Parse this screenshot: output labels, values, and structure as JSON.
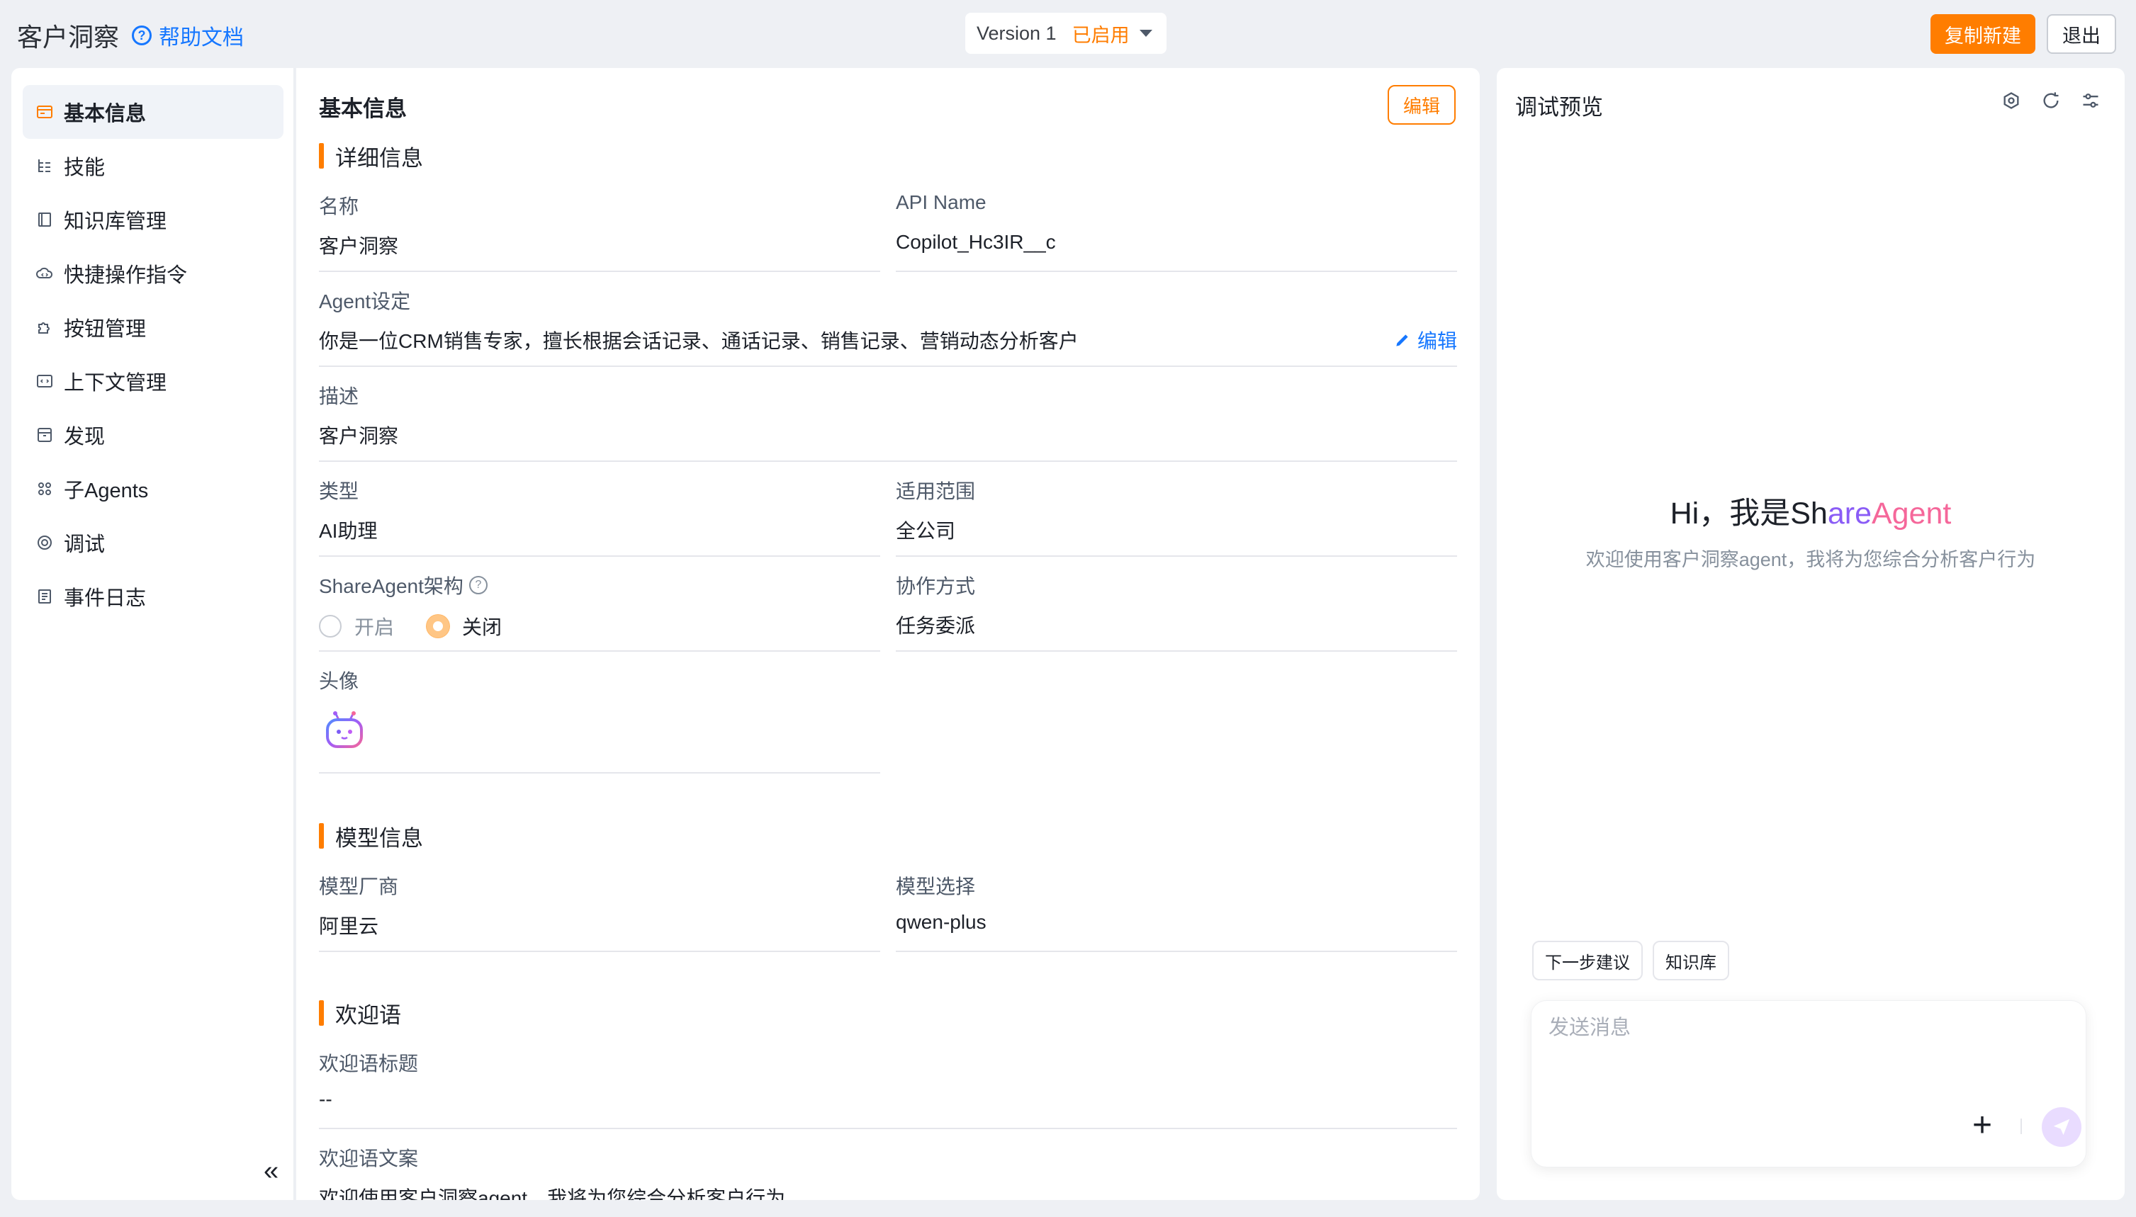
{
  "header": {
    "app_title": "客户洞察",
    "help_label": "帮助文档",
    "version_label": "Version 1",
    "version_status": "已启用",
    "copy_new_label": "复制新建",
    "exit_label": "退出"
  },
  "sidebar": {
    "items": [
      {
        "label": "基本信息",
        "icon": "card-icon"
      },
      {
        "label": "技能",
        "icon": "tree-list-icon"
      },
      {
        "label": "知识库管理",
        "icon": "book-icon"
      },
      {
        "label": "快捷操作指令",
        "icon": "cloud-command-icon"
      },
      {
        "label": "按钮管理",
        "icon": "puzzle-icon"
      },
      {
        "label": "上下文管理",
        "icon": "code-icon"
      },
      {
        "label": "发现",
        "icon": "box-icon"
      },
      {
        "label": "子Agents",
        "icon": "agents-icon"
      },
      {
        "label": "调试",
        "icon": "debug-icon"
      },
      {
        "label": "事件日志",
        "icon": "log-icon"
      }
    ],
    "collapse_symbol": "«"
  },
  "main": {
    "title": "基本信息",
    "edit_label": "编辑",
    "details_section": "详细信息",
    "fields": {
      "name_label": "名称",
      "name_value": "客户洞察",
      "api_name_label": "API Name",
      "api_name_value": "Copilot_Hc3IR__c",
      "agent_setting_label": "Agent设定",
      "agent_setting_value": "你是一位CRM销售专家，擅长根据会话记录、通话记录、销售记录、营销动态分析客户",
      "agent_setting_edit": "编辑",
      "desc_label": "描述",
      "desc_value": "客户洞察",
      "type_label": "类型",
      "type_value": "AI助理",
      "scope_label": "适用范围",
      "scope_value": "全公司",
      "arch_label": "ShareAgent架构",
      "arch_on": "开启",
      "arch_off": "关闭",
      "collab_label": "协作方式",
      "collab_value": "任务委派",
      "avatar_label": "头像"
    },
    "model_section": "模型信息",
    "model": {
      "vendor_label": "模型厂商",
      "vendor_value": "阿里云",
      "model_label": "模型选择",
      "model_value": "qwen-plus"
    },
    "welcome_section": "欢迎语",
    "welcome": {
      "title_label": "欢迎语标题",
      "title_value": "--",
      "text_label": "欢迎语文案",
      "text_value": "欢迎使用客户洞察agent，我将为您综合分析客户行为"
    }
  },
  "preview": {
    "title": "调试预览",
    "hi_prefix": "Hi，我是",
    "brand_a": "Sh",
    "brand_b": "are",
    "brand_c": "Agent",
    "subtitle": "欢迎使用客户洞察agent，我将为您综合分析客户行为",
    "chips": [
      "下一步建议",
      "知识库"
    ],
    "input_placeholder": "发送消息"
  },
  "colors": {
    "accent": "#ff7d00",
    "link": "#1677ff",
    "brand_purple": "#8a5cf6",
    "brand_pink": "#f5679a"
  }
}
